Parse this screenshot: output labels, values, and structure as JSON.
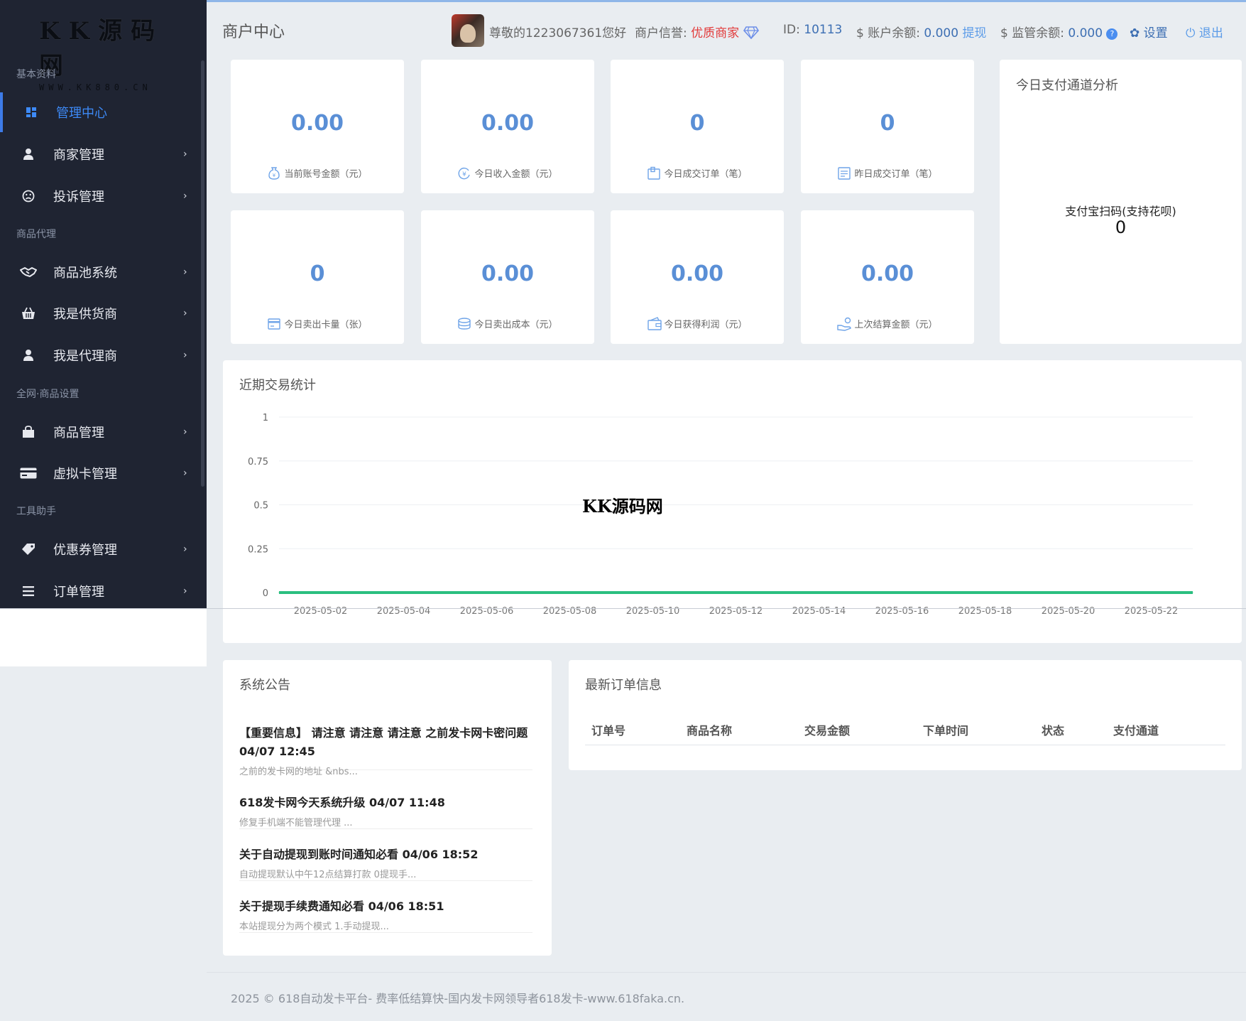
{
  "logo": {
    "main": "KK源码网",
    "sub": "WWW.KK880.CN"
  },
  "sidebar": {
    "sections": [
      "基本资料",
      "商品代理",
      "全网·商品设置",
      "工具助手"
    ],
    "items": [
      {
        "label": "管理中心",
        "icon": "dashboard-icon"
      },
      {
        "label": "商家管理",
        "icon": "user-icon"
      },
      {
        "label": "投诉管理",
        "icon": "frown-icon"
      },
      {
        "label": "商品池系统",
        "icon": "handshake-icon"
      },
      {
        "label": "我是供货商",
        "icon": "basket-icon"
      },
      {
        "label": "我是代理商",
        "icon": "user-icon"
      },
      {
        "label": "商品管理",
        "icon": "shopping-bag-icon"
      },
      {
        "label": "虚拟卡管理",
        "icon": "credit-card-icon"
      },
      {
        "label": "优惠券管理",
        "icon": "ticket-icon"
      },
      {
        "label": "订单管理",
        "icon": "list-icon"
      }
    ]
  },
  "header": {
    "title": "商户中心",
    "greeting": "尊敬的1223067361您好",
    "credit_label": "商户信誉:",
    "credit_value": "优质商家",
    "id_label": "ID:",
    "id_value": "10113",
    "balance_label": "$ 账户余额:",
    "balance_value": "0.000",
    "withdraw": "提现",
    "supervise_label": "$ 监管余额:",
    "supervise_value": "0.000",
    "help": "?",
    "settings": "设置",
    "logout": "退出"
  },
  "stats": [
    {
      "value": "0.00",
      "label": "当前账号金额（元）",
      "icon": "money-bag-icon"
    },
    {
      "value": "0.00",
      "label": "今日收入金额（元）",
      "icon": "yuan-refresh-icon"
    },
    {
      "value": "0",
      "label": "今日成交订单（笔）",
      "icon": "order-clipboard-icon"
    },
    {
      "value": "0",
      "label": "昨日成交订单（笔）",
      "icon": "document-icon"
    },
    {
      "value": "0",
      "label": "今日卖出卡量（张）",
      "icon": "card-sold-icon"
    },
    {
      "value": "0.00",
      "label": "今日卖出成本（元）",
      "icon": "coins-icon"
    },
    {
      "value": "0.00",
      "label": "今日获得利润（元）",
      "icon": "wallet-icon"
    },
    {
      "value": "0.00",
      "label": "上次结算金额（元）",
      "icon": "hand-coin-icon"
    }
  ],
  "pay_channel": {
    "title": "今日支付通道分析",
    "name": "支付宝扫码(支持花呗)",
    "value": "0"
  },
  "watermark": "KK源码网",
  "chart_data": {
    "type": "line",
    "title": "近期交易统计",
    "xlabel": "",
    "ylabel": "",
    "x": [
      "2025-05-01",
      "2025-05-02",
      "2025-05-03",
      "2025-05-04",
      "2025-05-05",
      "2025-05-06",
      "2025-05-07",
      "2025-05-08",
      "2025-05-09",
      "2025-05-10",
      "2025-05-11",
      "2025-05-12",
      "2025-05-13",
      "2025-05-14",
      "2025-05-15",
      "2025-05-16",
      "2025-05-17",
      "2025-05-18",
      "2025-05-19",
      "2025-05-20",
      "2025-05-21",
      "2025-05-22",
      "2025-05-23"
    ],
    "x_ticks": [
      "2025-05-02",
      "2025-05-04",
      "2025-05-06",
      "2025-05-08",
      "2025-05-10",
      "2025-05-12",
      "2025-05-14",
      "2025-05-16",
      "2025-05-18",
      "2025-05-20",
      "2025-05-22"
    ],
    "y_ticks": [
      "1",
      "0.75",
      "0.5",
      "0.25",
      "0"
    ],
    "ylim": [
      0,
      1
    ],
    "grid": true,
    "series": [
      {
        "values": [
          0,
          0,
          0,
          0,
          0,
          0,
          0,
          0,
          0,
          0,
          0,
          0,
          0,
          0,
          0,
          0,
          0,
          0,
          0,
          0,
          0,
          0,
          0
        ],
        "color": "#2bbf80"
      }
    ]
  },
  "notices": {
    "title": "系统公告",
    "items": [
      {
        "title": "【重要信息】 请注意 请注意 请注意 之前发卡网卡密问题 04/07 12:45",
        "desc": "之前的发卡网的地址 &nbs..."
      },
      {
        "title": "618发卡网今天系统升级 04/07 11:48",
        "desc": "修复手机端不能管理代理 ..."
      },
      {
        "title": "关于自动提现到账时间通知必看 04/06 18:52",
        "desc": "自动提现默认中午12点结算打款 0提现手..."
      },
      {
        "title": "关于提现手续费通知必看 04/06 18:51",
        "desc": "本站提现分为两个模式 1.手动提现..."
      }
    ]
  },
  "orders": {
    "title": "最新订单信息",
    "columns": [
      "订单号",
      "商品名称",
      "交易金额",
      "下单时间",
      "状态",
      "支付通道"
    ]
  },
  "footer": "2025 © 618自动发卡平台- 费率低结算快-国内发卡网领导者618发卡-www.618faka.cn.",
  "colors": {
    "accent": "#3d8af7",
    "stat_value": "#5a8fd6",
    "line": "#2bbf80",
    "sidebar": "#1f2432",
    "credit": "#e23b3b"
  }
}
